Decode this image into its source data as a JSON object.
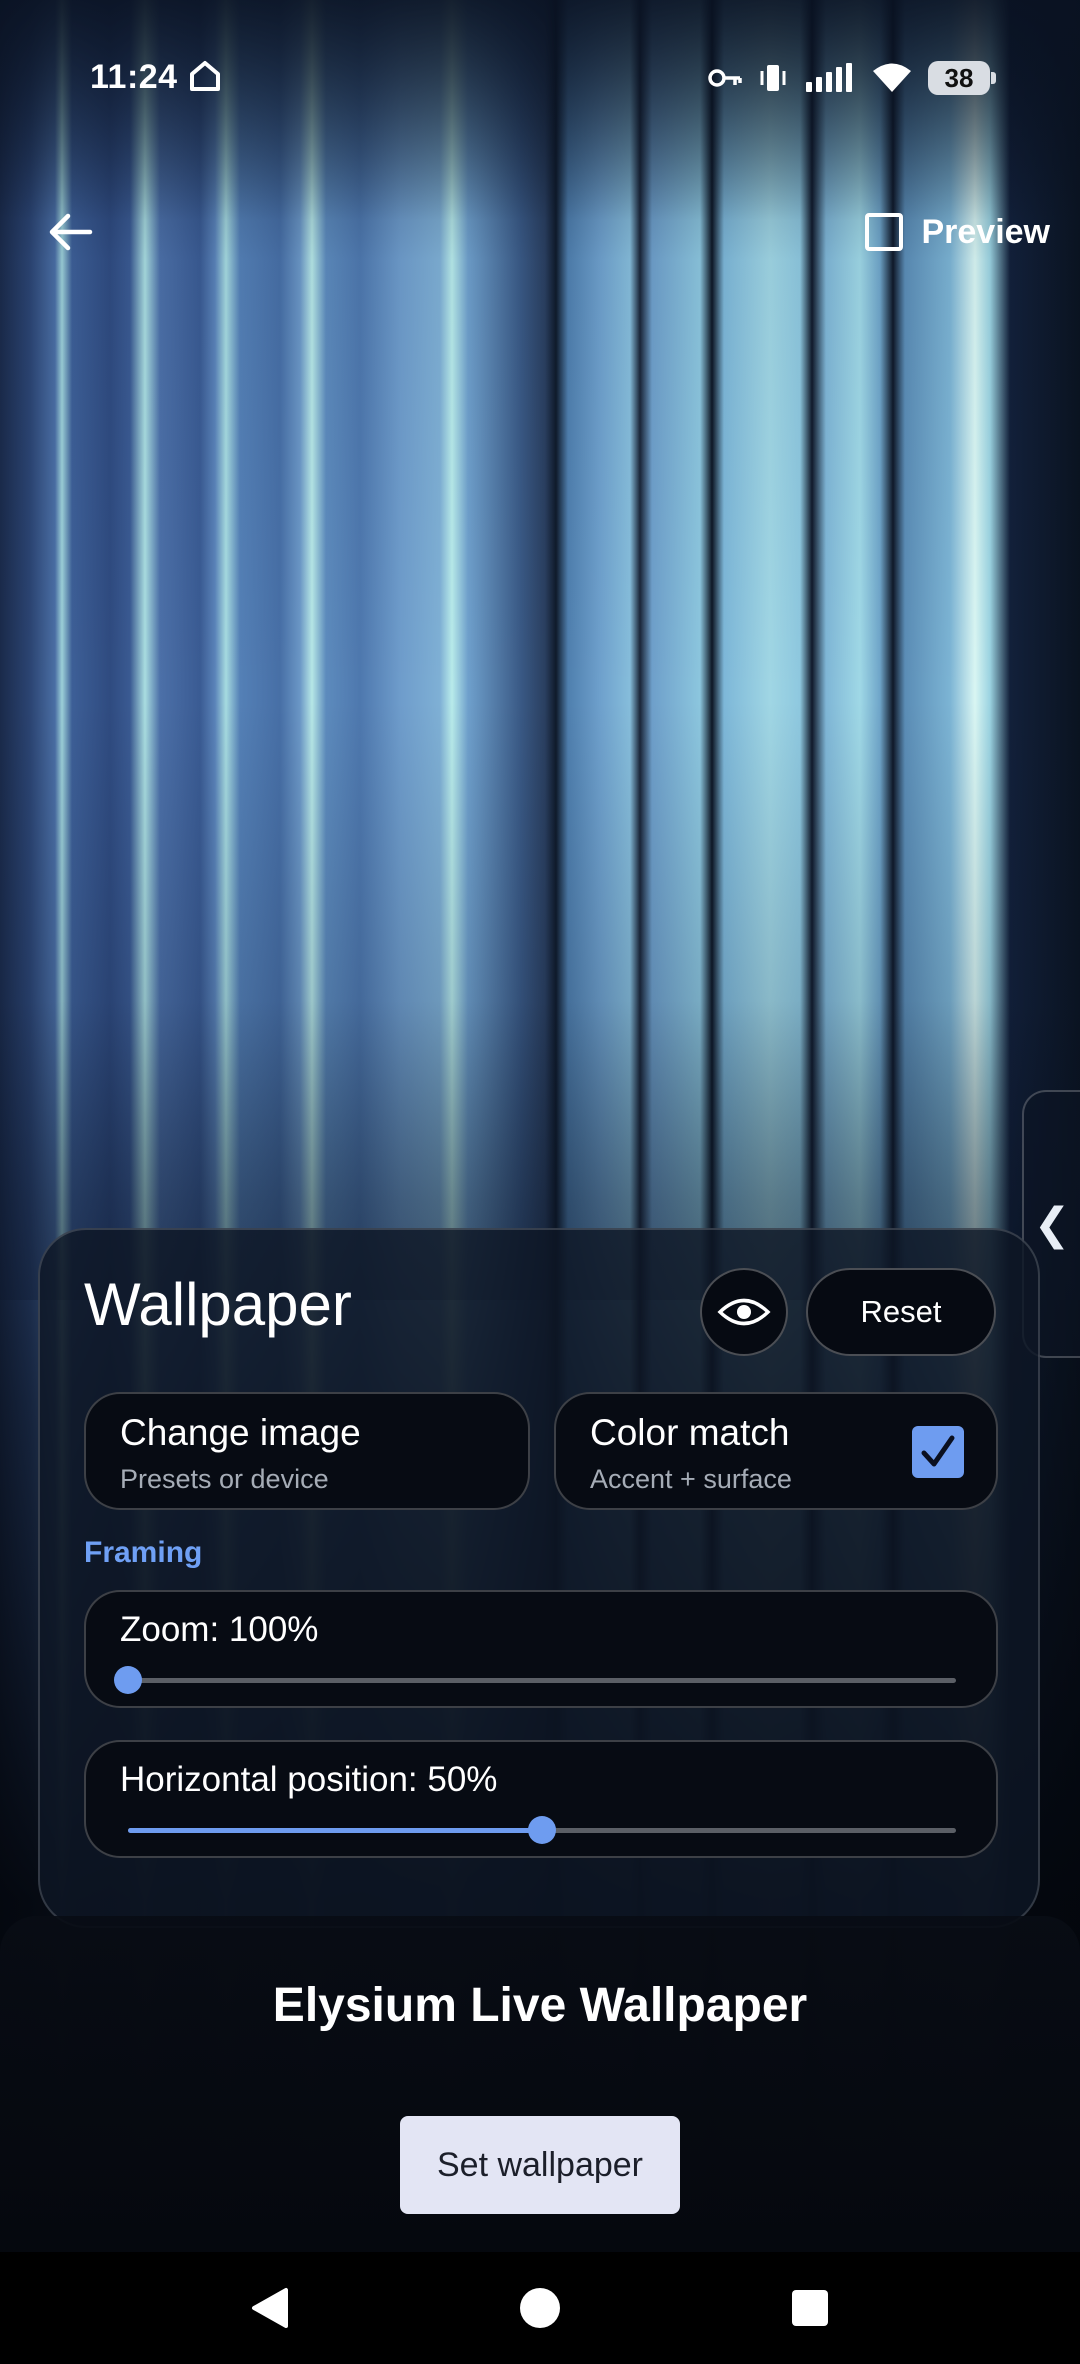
{
  "status_bar": {
    "time": "11:24",
    "battery": "38",
    "icons": [
      "home-icon",
      "vpn-key-icon",
      "vibrate-icon",
      "signal-icon",
      "wifi-icon",
      "battery-icon"
    ]
  },
  "top_bar": {
    "back_icon": "arrow-left-icon",
    "preview_label": "Preview",
    "preview_checked": false
  },
  "panel": {
    "title": "Wallpaper",
    "eye_icon": "eye-icon",
    "reset_label": "Reset",
    "change_image": {
      "title": "Change image",
      "subtitle": "Presets or device"
    },
    "color_match": {
      "title": "Color match",
      "subtitle": "Accent + surface",
      "checked": true
    },
    "section_label": "Framing",
    "zoom": {
      "label": "Zoom: 100%",
      "value": 0.0
    },
    "horizontal_position": {
      "label": "Horizontal position: 50%",
      "value": 0.5
    }
  },
  "side_handle_icon": "chevron-left-icon",
  "bottom": {
    "app_name": "Elysium Live Wallpaper",
    "set_button": "Set wallpaper"
  },
  "colors": {
    "accent": "#6e9cf0",
    "set_button_bg": "#e3e5f4"
  },
  "nav_bar": {
    "icons": [
      "back-triangle-icon",
      "home-circle-icon",
      "recents-square-icon"
    ]
  }
}
